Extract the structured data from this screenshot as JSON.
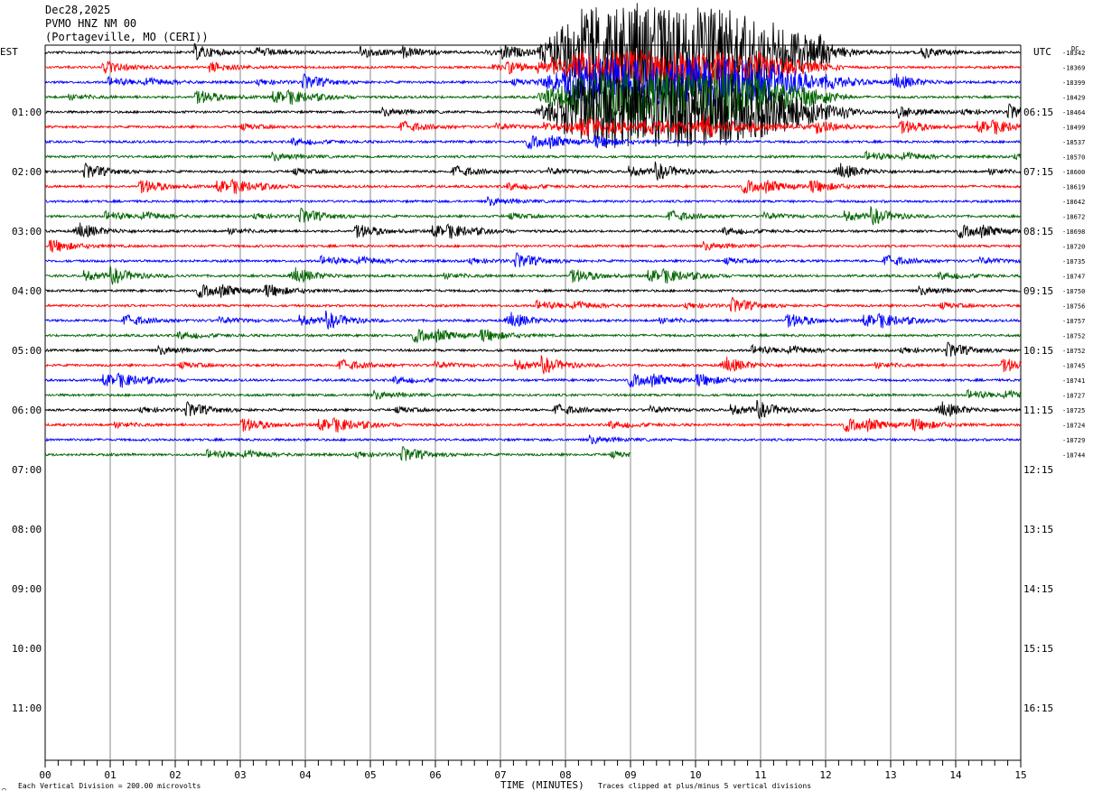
{
  "header": {
    "date": "Dec28,2025",
    "station": "PVMO HNZ NM 00",
    "location": "(Portageville, MO (CERI))"
  },
  "footer": {
    "division_note": "Each Vertical Division =  200.00 microvolts",
    "clip_note": "Traces clipped at plus/minus 5 vertical divisions",
    "mark": "⌒"
  },
  "chart_data": {
    "type": "line",
    "title": "",
    "xlabel": "TIME (MINUTES)",
    "ylabel_left": "EST",
    "ylabel_right": "UTC",
    "dc_label": "DC",
    "xlim": [
      0,
      15
    ],
    "x_ticks": [
      "00",
      "01",
      "02",
      "03",
      "04",
      "05",
      "06",
      "07",
      "08",
      "09",
      "10",
      "11",
      "12",
      "13",
      "14",
      "15"
    ],
    "left_hour_labels": [
      "01:00",
      "02:00",
      "03:00",
      "04:00",
      "05:00",
      "06:00",
      "07:00",
      "08:00",
      "09:00",
      "10:00",
      "11:00"
    ],
    "right_hour_labels": [
      "06:15",
      "07:15",
      "08:15",
      "09:15",
      "10:15",
      "11:15",
      "12:15",
      "13:15",
      "14:15",
      "15:15",
      "16:15"
    ],
    "trace_colors": [
      "#000000",
      "#ff0000",
      "#0000ff",
      "#006400"
    ],
    "dc_offsets": [
      -18342,
      -18369,
      -18399,
      -18429,
      -18464,
      -18499,
      -18537,
      -18570,
      -18600,
      -18619,
      -18642,
      -18672,
      -18698,
      -18720,
      -18735,
      -18747,
      -18750,
      -18756,
      -18757,
      -18752,
      -18752,
      -18745,
      -18741,
      -18727,
      -18725,
      -18724,
      -18729,
      -18744
    ],
    "trace_count": 28,
    "last_trace_end_minute": 9.0,
    "event": {
      "start_minute": 7.5,
      "peak_start_minute": 8.3,
      "peak_end_minute": 10.4,
      "end_minute": 12.5,
      "first_trace": 0,
      "traces_affected": 6
    },
    "grid": true
  }
}
